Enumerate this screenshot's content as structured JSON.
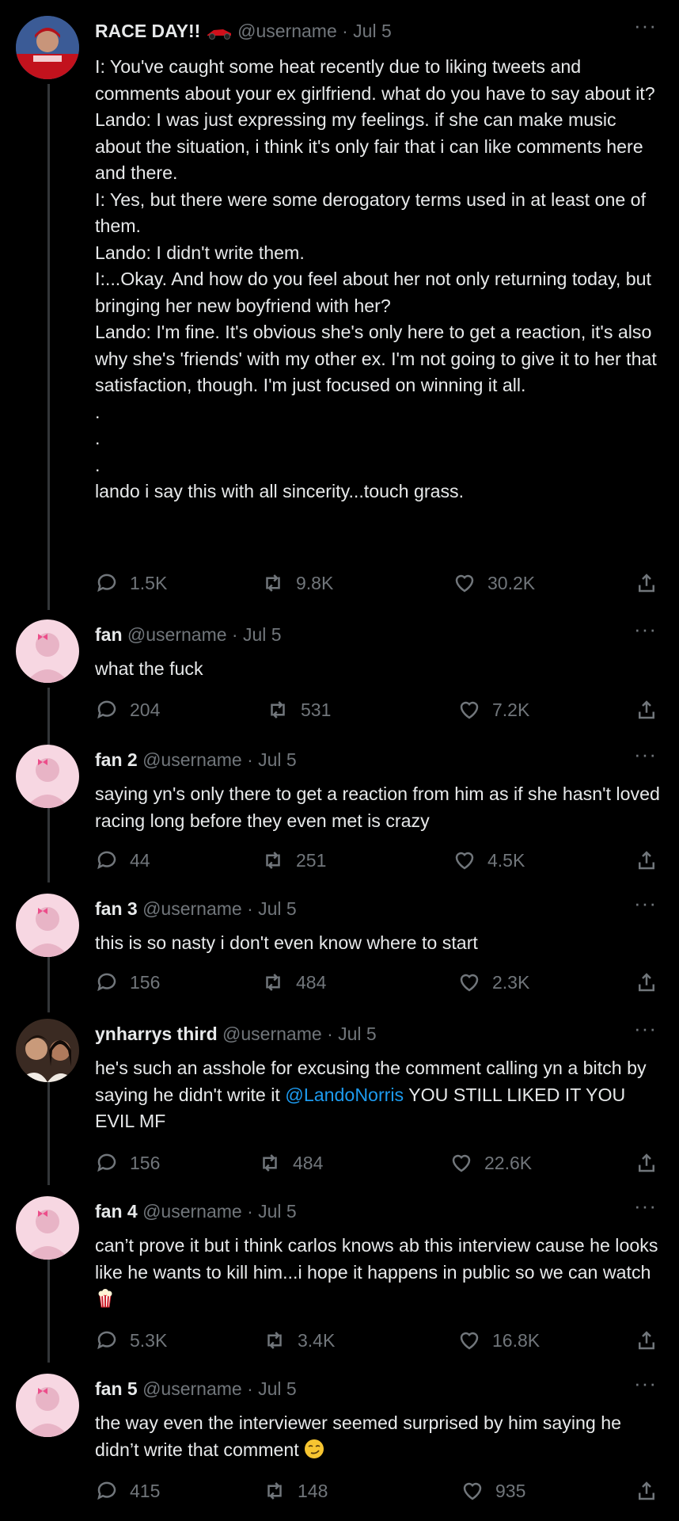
{
  "tweets": [
    {
      "name": "RACE DAY!!",
      "handle": "@username",
      "date": "· Jul 5",
      "body": "I: You've caught some heat recently due to liking tweets and comments about your ex girlfriend. what do you have to say about it?\nLando: I was just expressing my feelings. if she can make music about the situation, i think it's only fair that i can like comments here and there.\nI: Yes, but there were some derogatory terms used in at least one of them.\nLando: I didn't write them.\nI:...Okay. And how do you feel about her not only returning today, but bringing her new boyfriend with her?\nLando: I'm fine. It's obvious she's only here to get a reaction, it's also why she's 'friends' with my other ex. I'm not going to give it to her that satisfaction, though. I'm just focused on winning it all.\n.\n.\n.\nlando i say this with all sincerity...touch grass.",
      "replies": "1.5K",
      "retweets": "9.8K",
      "likes": "30.2K"
    },
    {
      "name": "fan",
      "handle": "@username",
      "date": "· Jul 5",
      "body": "what the fuck",
      "replies": "204",
      "retweets": "531",
      "likes": "7.2K"
    },
    {
      "name": "fan 2",
      "handle": "@username",
      "date": "· Jul 5",
      "body": "saying yn's only there to get a reaction from him as if she hasn't loved racing long before they even met is crazy",
      "replies": "44",
      "retweets": "251",
      "likes": "4.5K"
    },
    {
      "name": "fan 3",
      "handle": "@username",
      "date": "· Jul 5",
      "body": "this is so nasty i don't even know where to start",
      "replies": "156",
      "retweets": "484",
      "likes": "2.3K"
    },
    {
      "name": "ynharrys third",
      "handle": "@username",
      "date": "· Jul 5",
      "body_pre": "he's such an asshole for excusing the comment calling yn a bitch by saying he didn't write it ",
      "mention": "@LandoNorris",
      "body_post": " YOU STILL LIKED IT YOU EVIL MF",
      "replies": "156",
      "retweets": "484",
      "likes": "22.6K"
    },
    {
      "name": "fan 4",
      "handle": "@username",
      "date": "· Jul 5",
      "body": "can’t prove it but i think carlos knows ab this interview cause he looks like he wants to kill him...i hope it happens in public so we can watch ",
      "emoji": "popcorn-icon",
      "replies": "5.3K",
      "retweets": "3.4K",
      "likes": "16.8K"
    },
    {
      "name": "fan 5",
      "handle": "@username",
      "date": "· Jul 5",
      "body": "the way even the interviewer seemed surprised by him saying he didn’t write that comment ",
      "emoji": "smirk-face-icon",
      "replies": "415",
      "retweets": "148",
      "likes": "935"
    }
  ],
  "colors": {
    "background": "#000000",
    "text": "#e7e9ea",
    "muted": "#71767b",
    "link": "#1d9bf0",
    "avatar_pink": "#f7d7e2"
  }
}
